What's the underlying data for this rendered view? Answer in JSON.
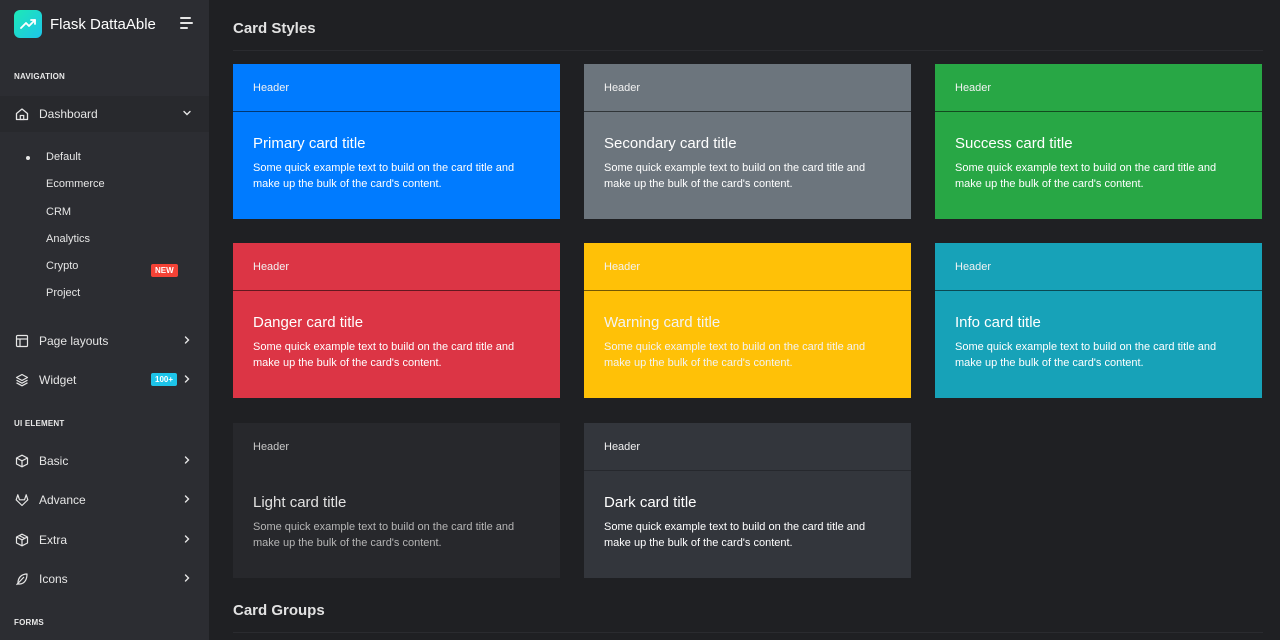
{
  "brand": {
    "name": "Flask DattaAble"
  },
  "sidebar": {
    "captions": {
      "navigation": "NAVIGATION",
      "ui_element": "UI ELEMENT",
      "forms": "FORMS"
    },
    "dashboard": {
      "label": "Dashboard"
    },
    "dashboard_sub": [
      "Default",
      "Ecommerce",
      "CRM",
      "Analytics",
      "Crypto",
      "Project"
    ],
    "crypto_badge": "NEW",
    "page_layouts": {
      "label": "Page layouts"
    },
    "widget": {
      "label": "Widget",
      "badge": "100+"
    },
    "basic": {
      "label": "Basic"
    },
    "advance": {
      "label": "Advance"
    },
    "extra": {
      "label": "Extra"
    },
    "icons": {
      "label": "Icons"
    }
  },
  "main": {
    "section_card_styles": "Card Styles",
    "section_card_groups": "Card Groups",
    "cards": [
      {
        "header": "Header",
        "title": "Primary card title",
        "text": "Some quick example text to build on the card title and make up the bulk of the card's content.",
        "color": "#007bff"
      },
      {
        "header": "Header",
        "title": "Secondary card title",
        "text": "Some quick example text to build on the card title and make up the bulk of the card's content.",
        "color": "#6c757d"
      },
      {
        "header": "Header",
        "title": "Success card title",
        "text": "Some quick example text to build on the card title and make up the bulk of the card's content.",
        "color": "#28a745"
      },
      {
        "header": "Header",
        "title": "Danger card title",
        "text": "Some quick example text to build on the card title and make up the bulk of the card's content.",
        "color": "#dc3545"
      },
      {
        "header": "Header",
        "title": "Warning card title",
        "text": "Some quick example text to build on the card title and make up the bulk of the card's content.",
        "color": "#ffc107"
      },
      {
        "header": "Header",
        "title": "Info card title",
        "text": "Some quick example text to build on the card title and make up the bulk of the card's content.",
        "color": "#17a2b8"
      },
      {
        "header": "Header",
        "title": "Light card title",
        "text": "Some quick example text to build on the card title and make up the bulk of the card's content.",
        "color": "#27282c"
      },
      {
        "header": "Header",
        "title": "Dark card title",
        "text": "Some quick example text to build on the card title and make up the bulk of the card's content.",
        "color": "#33363c"
      }
    ]
  },
  "colors": {
    "badge_new": "#f44236",
    "badge_widget": "#1dc4e9",
    "brand_gradient_start": "#1de9b6",
    "brand_gradient_end": "#1dc4e9"
  }
}
